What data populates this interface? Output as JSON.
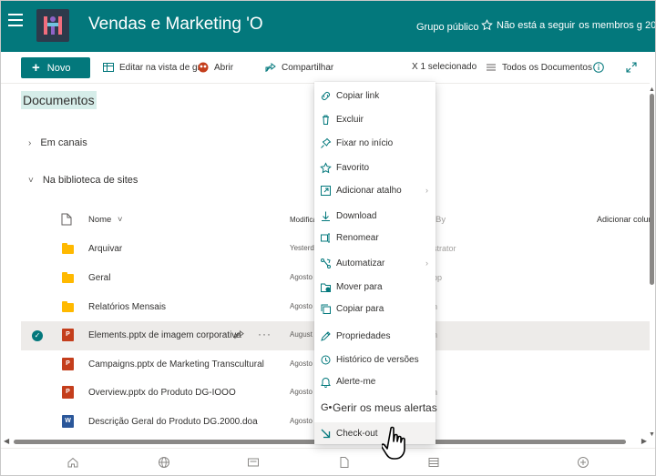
{
  "header": {
    "site_title": "Vendas e Marketing 'O",
    "group_label": "Grupo público",
    "follow_label": "Não está a seguir",
    "members_label": "os membros g 20",
    "bg_color": "#03787c"
  },
  "commandbar": {
    "new_label": "Novo",
    "edit_grid_label": "Editar na vista de gre",
    "open_label": "Abrir",
    "share_label": "Compartilhar",
    "selected_label": "X 1 selecionado",
    "view_label": "Todos os Documentos"
  },
  "content": {
    "doc_title": "Documentos",
    "section_channels": "Em canais",
    "section_site_library": "Na biblioteca de sites",
    "col_name": "Nome",
    "col_modified": "Modificar",
    "col_by": "By",
    "col_add": "Adicionar colur",
    "rows": [
      {
        "name": "Arquivar",
        "type": "folder",
        "modified": "Yesterd",
        "by": "strator",
        "selected": false
      },
      {
        "name": "Geral",
        "type": "folder",
        "modified": "Agosto",
        "by": "pp",
        "selected": false
      },
      {
        "name": "Relatórios Mensais",
        "type": "folder",
        "modified": "Agosto",
        "by": "n",
        "selected": false
      },
      {
        "name": "Elements.pptx de imagem corporativa",
        "type": "pptx",
        "modified": "August",
        "by": "n",
        "selected": true
      },
      {
        "name": "Campaigns.pptx de Marketing Transcultural",
        "type": "pptx",
        "modified": "Agosto",
        "by": "",
        "selected": false
      },
      {
        "name": "Overview.pptx do Produto DG-IOOO",
        "type": "pptx",
        "modified": "Agosto",
        "by": "n",
        "selected": false
      },
      {
        "name": "Descrição Geral do Produto DG.2000.doa",
        "type": "docx",
        "modified": "Agosto",
        "by": "",
        "selected": false
      }
    ]
  },
  "menu": {
    "items": [
      {
        "label": "Copiar link",
        "icon": "link-icon"
      },
      {
        "label": "Excluir",
        "icon": "trash-icon"
      },
      {
        "label": "Fixar no início",
        "icon": "pin-icon"
      },
      {
        "label": "Favorito",
        "icon": "star-icon"
      },
      {
        "label": "Adicionar atalho",
        "icon": "shortcut-icon",
        "submenu": true
      },
      {
        "label": "Download",
        "icon": "download-icon"
      },
      {
        "label": "Renomear",
        "icon": "rename-icon"
      },
      {
        "label": "Automatizar",
        "icon": "automate-icon",
        "submenu": true
      },
      {
        "label": "Mover para",
        "icon": "move-icon"
      },
      {
        "label": "Copiar para",
        "icon": "copy-icon"
      },
      {
        "label": "Propriedades",
        "icon": "edit-icon"
      },
      {
        "label": "Histórico de versões",
        "icon": "history-icon"
      },
      {
        "label": "Alerte-me",
        "icon": "bell-icon"
      },
      {
        "label": "Gerir os meus alertas",
        "icon": "alerts-icon"
      },
      {
        "label": "Check-out",
        "icon": "checkout-icon"
      }
    ]
  },
  "icons": {
    "ppt_glyph": "P",
    "doc_glyph": "W"
  }
}
